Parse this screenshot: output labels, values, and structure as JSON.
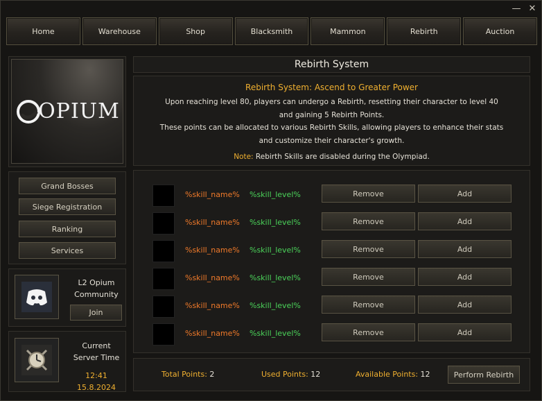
{
  "window": {
    "minimize_glyph": "—",
    "close_glyph": "✕"
  },
  "nav": [
    {
      "label": "Home"
    },
    {
      "label": "Warehouse"
    },
    {
      "label": "Shop"
    },
    {
      "label": "Blacksmith"
    },
    {
      "label": "Mammon"
    },
    {
      "label": "Rebirth"
    },
    {
      "label": "Auction"
    }
  ],
  "logo": {
    "text": "OPIUM"
  },
  "sidebar": {
    "buttons": [
      {
        "label": "Grand Bosses"
      },
      {
        "label": "Siege Registration"
      },
      {
        "label": "Ranking"
      },
      {
        "label": "Services"
      }
    ],
    "community": {
      "line1": "L2 Opium",
      "line2": "Community",
      "join_label": "Join",
      "icon": "discord-icon"
    },
    "server_time": {
      "line1": "Current",
      "line2": "Server Time",
      "value": "12:41 15.8.2024",
      "icon": "clock-icon"
    }
  },
  "main": {
    "title": "Rebirth System",
    "heading": "Rebirth System: Ascend to Greater Power",
    "desc_lines": [
      "Upon reaching level 80, players can undergo a Rebirth, resetting their character to level 40",
      "and gaining 5 Rebirth Points.",
      "These points can be allocated to various Rebirth Skills, allowing players to enhance their stats",
      "and customize their character's growth."
    ],
    "note_label": "Note:",
    "note_text": " Rebirth Skills are disabled during the Olympiad."
  },
  "skills": [
    {
      "name": "%skill_name%",
      "level": "%skill_level%",
      "remove": "Remove",
      "add": "Add"
    },
    {
      "name": "%skill_name%",
      "level": "%skill_level%",
      "remove": "Remove",
      "add": "Add"
    },
    {
      "name": "%skill_name%",
      "level": "%skill_level%",
      "remove": "Remove",
      "add": "Add"
    },
    {
      "name": "%skill_name%",
      "level": "%skill_level%",
      "remove": "Remove",
      "add": "Add"
    },
    {
      "name": "%skill_name%",
      "level": "%skill_level%",
      "remove": "Remove",
      "add": "Add"
    },
    {
      "name": "%skill_name%",
      "level": "%skill_level%",
      "remove": "Remove",
      "add": "Add"
    }
  ],
  "footer": {
    "total_label": "Total Points:",
    "total_value": " 2",
    "used_label": "Used Points:",
    "used_value": " 12",
    "available_label": "Available Points:",
    "available_value": " 12",
    "perform_label": "Perform Rebirth"
  },
  "colors": {
    "accent": "#f0b030",
    "skill_name": "#f07a2a",
    "skill_level": "#4bd35a"
  }
}
